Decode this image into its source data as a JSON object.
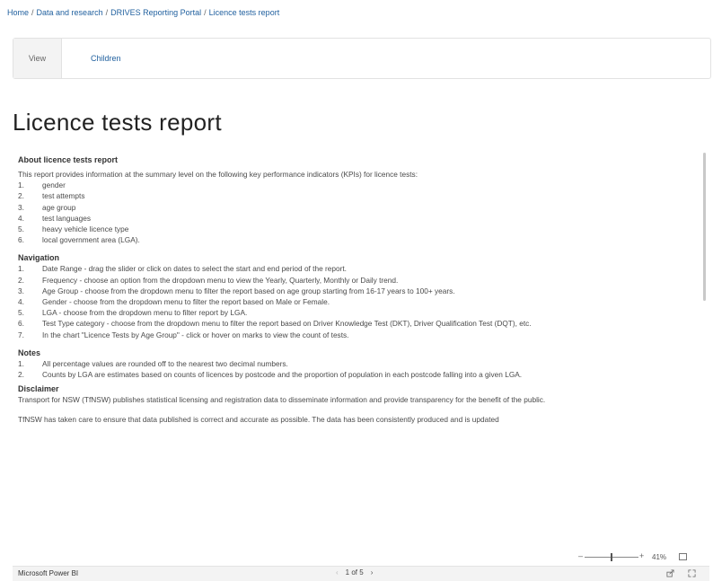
{
  "breadcrumb": {
    "items": [
      "Home",
      "Data and research",
      "DRIVES Reporting Portal",
      "Licence tests report"
    ],
    "separator": "/"
  },
  "tabs": [
    {
      "label": "View",
      "active": true
    },
    {
      "label": "Children",
      "active": false
    }
  ],
  "page": {
    "title": "Licence tests report"
  },
  "report": {
    "about": {
      "heading": "About licence tests report",
      "intro": "This report provides information at the summary level on the following key performance indicators (KPIs) for licence tests:",
      "items": [
        "gender",
        "test attempts",
        "age group",
        "test languages",
        "heavy vehicle licence type",
        "local government area (LGA)."
      ]
    },
    "navigation": {
      "heading": "Navigation",
      "items": [
        "Date Range - drag the slider or click on dates to select the start and end period of the report.",
        "Frequency - choose an option from the dropdown menu to view the Yearly, Quarterly, Monthly or Daily trend.",
        "Age Group - choose from the dropdown menu to filter the report based on age group starting from 16-17 years to 100+ years.",
        "Gender - choose from the dropdown menu to filter the report based on Male or Female.",
        "LGA - choose from the dropdown menu to filter report by LGA.",
        "Test Type category - choose from the dropdown menu to filter the report based on Driver Knowledge Test (DKT), Driver Qualification Test (DQT), etc.",
        "In the chart \"Licence Tests by Age Group\" - click or hover on marks to view the count of tests."
      ]
    },
    "notes": {
      "heading": "Notes",
      "items": [
        "All percentage values are rounded off to the nearest two decimal numbers.",
        "Counts by LGA are estimates based on counts of licences by postcode and the proportion of population in each postcode falling into a given LGA."
      ]
    },
    "disclaimer": {
      "heading": "Disclaimer",
      "p1": "Transport for NSW (TfNSW) publishes statistical licensing and registration data to disseminate information and provide transparency for the benefit of the public.",
      "p2": "TfNSW has taken care to ensure that data published is correct and accurate as possible. The data has been consistently produced and is updated"
    },
    "zoom": {
      "minus": "–",
      "plus": "+",
      "percent": "41%",
      "level": 0.5
    },
    "footer": {
      "brand": "Microsoft Power BI",
      "page_indicator": "1 of 5",
      "prev": "‹",
      "next": "›"
    }
  }
}
